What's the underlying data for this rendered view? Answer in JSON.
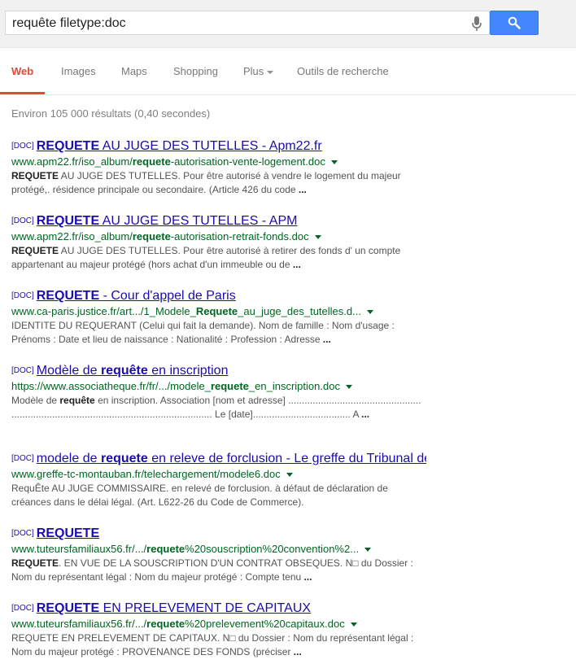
{
  "search": {
    "query": "requête filetype:doc"
  },
  "tabs": [
    {
      "label": "Web"
    },
    {
      "label": "Images"
    },
    {
      "label": "Maps"
    },
    {
      "label": "Shopping"
    },
    {
      "label": "Plus"
    },
    {
      "label": "Outils de recherche"
    }
  ],
  "stats": "Environ 105 000 résultats (0,40 secondes)",
  "results": [
    {
      "tag": "[DOC]",
      "title": [
        {
          "b": "REQUETE"
        },
        {
          "t": " AU JUGE DES TUTELLES - Apm22.fr"
        }
      ],
      "url": [
        {
          "t": "www.apm22.fr/iso_album/"
        },
        {
          "b": "requete"
        },
        {
          "t": "-autorisation-vente-logement.doc"
        }
      ],
      "snippet": [
        {
          "b": "REQUETE"
        },
        {
          "t": " AU JUGE DES TUTELLES. Pour être autorisé à vendre le logement du majeur protégé,. résidence principale ou secondaire. (Article 426 du code "
        },
        {
          "b": "..."
        }
      ]
    },
    {
      "tag": "[DOC]",
      "title": [
        {
          "b": "REQUETE"
        },
        {
          "t": " AU JUGE DES TUTELLES - APM"
        }
      ],
      "url": [
        {
          "t": "www.apm22.fr/iso_album/"
        },
        {
          "b": "requete"
        },
        {
          "t": "-autorisation-retrait-fonds.doc"
        }
      ],
      "snippet": [
        {
          "b": "REQUETE"
        },
        {
          "t": " AU JUGE DES TUTELLES. Pour être autorisé à retirer des fonds d' un compte appartenant au majeur protégé (hors achat d'un immeuble ou de "
        },
        {
          "b": "..."
        }
      ]
    },
    {
      "tag": "[DOC]",
      "title": [
        {
          "b": "REQUETE"
        },
        {
          "t": " - Cour d'appel de Paris"
        }
      ],
      "url": [
        {
          "t": "www.ca-paris.justice.fr/art.../1_Modele_"
        },
        {
          "b": "Requete"
        },
        {
          "t": "_au_juge_des_tutelles.d..."
        }
      ],
      "snippet": [
        {
          "t": "IDENTITE DU REQUERANT (Celui qui fait la demande). Nom de famille : Nom d'usage : Prénoms : Date et lieu de naissance : Nationalité : Profession : Adresse "
        },
        {
          "b": "..."
        }
      ]
    },
    {
      "tag": "[DOC]",
      "title": [
        {
          "t": "Modèle de "
        },
        {
          "b": "requête"
        },
        {
          "t": " en inscription"
        }
      ],
      "url": [
        {
          "t": "https://www.associatheque.fr/fr/.../modele_"
        },
        {
          "b": "requete"
        },
        {
          "t": "_en_inscription.doc"
        }
      ],
      "snippet": [
        {
          "t": "Modèle de "
        },
        {
          "b": "requête"
        },
        {
          "t": " en inscription. Association [nom et adresse] ................................................. .......................................................................... Le [date].................................... A "
        },
        {
          "b": "..."
        }
      ]
    },
    {
      "tag": "[DOC]",
      "title": [
        {
          "t": "modele de "
        },
        {
          "b": "requete"
        },
        {
          "t": " en releve de forclusion - Le greffe du Tribunal de Commerce"
        }
      ],
      "url": [
        {
          "t": "www.greffe-tc-montauban.fr/telechargement/modele6.doc"
        }
      ],
      "snippet": [
        {
          "t": "RequÊte AU JUGE COMMISSAIRE. en relevé de forclusion. à défaut de déclaration de créances dans le délai légal. (Art. L622-26 du Code de Commerce)."
        }
      ]
    },
    {
      "tag": "[DOC]",
      "title": [
        {
          "b": "REQUETE"
        }
      ],
      "url": [
        {
          "t": "www.tuteursfamiliaux56.fr/.../"
        },
        {
          "b": "requete"
        },
        {
          "t": "%20souscription%20convention%2..."
        }
      ],
      "snippet": [
        {
          "b": "REQUETE"
        },
        {
          "t": ". EN VUE DE LA SOUSCRIPTION D'UN CONTRAT OBSEQUES. N□ du Dossier : Nom du représentant légal : Nom du majeur protégé : Compte tenu "
        },
        {
          "b": "..."
        }
      ]
    },
    {
      "tag": "[DOC]",
      "title": [
        {
          "b": "REQUETE"
        },
        {
          "t": " EN PRELEVEMENT DE CAPITAUX"
        }
      ],
      "url": [
        {
          "t": "www.tuteursfamiliaux56.fr/.../"
        },
        {
          "b": "requete"
        },
        {
          "t": "%20prelevement%20capitaux.doc"
        }
      ],
      "snippet": [
        {
          "t": "REQUETE EN PRELEVEMENT DE CAPITAUX. N□ du Dossier : Nom du représentant légal : Nom du majeur protégé : PROVENANCE DES FONDS (préciser "
        },
        {
          "b": "..."
        }
      ]
    }
  ]
}
